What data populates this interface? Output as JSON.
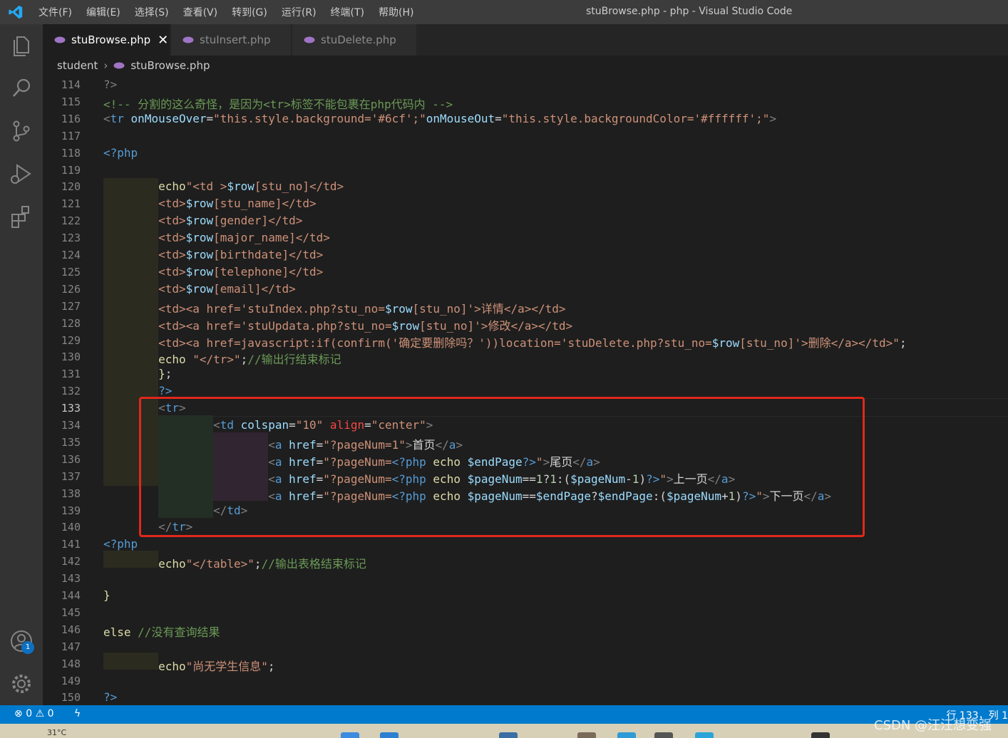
{
  "window": {
    "title": "stuBrowse.php - php - Visual Studio Code",
    "menu": [
      "文件(F)",
      "编辑(E)",
      "选择(S)",
      "查看(V)",
      "转到(G)",
      "运行(R)",
      "终端(T)",
      "帮助(H)"
    ]
  },
  "tabs": [
    {
      "label": "stuBrowse.php",
      "active": true,
      "close": "✕"
    },
    {
      "label": "stuInsert.php",
      "active": false
    },
    {
      "label": "stuDelete.php",
      "active": false
    }
  ],
  "breadcrumb": {
    "folder": "student",
    "separator": "›",
    "file": "stuBrowse.php"
  },
  "activity_bar": {
    "icons": [
      "explorer-icon",
      "search-icon",
      "source-control-icon",
      "run-debug-icon",
      "extensions-icon",
      "account-icon",
      "settings-gear-icon"
    ],
    "account_badge": "1"
  },
  "editor": {
    "active_line": "133",
    "highlight_color": "#e0281c",
    "lines": [
      {
        "n": "114",
        "segs": [
          {
            "c": "dim",
            "t": "?>"
          }
        ]
      },
      {
        "n": "115",
        "segs": [
          {
            "c": "cmt",
            "t": "<!-- 分割的这么奇怪，是因为<tr>标签不能包裹在php代码内 -->"
          }
        ]
      },
      {
        "n": "116",
        "segs": [
          {
            "c": "pun",
            "t": "<"
          },
          {
            "c": "tag",
            "t": "tr"
          },
          {
            "c": "txt",
            "t": " "
          },
          {
            "c": "attr",
            "t": "onMouseOver"
          },
          {
            "c": "txt",
            "t": "="
          },
          {
            "c": "str",
            "t": "\"this.style.background='#6cf';\""
          },
          {
            "c": "attr",
            "t": "onMouseOut"
          },
          {
            "c": "txt",
            "t": "="
          },
          {
            "c": "str",
            "t": "\"this.style.backgroundColor='#ffffff';\""
          },
          {
            "c": "pun",
            "t": ">"
          }
        ]
      },
      {
        "n": "117",
        "segs": []
      },
      {
        "n": "118",
        "segs": [
          {
            "c": "kw",
            "t": "<?php"
          }
        ]
      },
      {
        "n": "119",
        "segs": []
      },
      {
        "n": "120",
        "segs": [
          {
            "c": "txt",
            "t": "        "
          },
          {
            "c": "yel",
            "t": "echo"
          },
          {
            "c": "str",
            "t": "\"<td >"
          },
          {
            "c": "var",
            "t": "$row"
          },
          {
            "c": "str",
            "t": "[stu_no]</td>"
          }
        ]
      },
      {
        "n": "121",
        "segs": [
          {
            "c": "txt",
            "t": "        "
          },
          {
            "c": "str",
            "t": "<td>"
          },
          {
            "c": "var",
            "t": "$row"
          },
          {
            "c": "str",
            "t": "[stu_name]</td>"
          }
        ]
      },
      {
        "n": "122",
        "segs": [
          {
            "c": "txt",
            "t": "        "
          },
          {
            "c": "str",
            "t": "<td>"
          },
          {
            "c": "var",
            "t": "$row"
          },
          {
            "c": "str",
            "t": "[gender]</td>"
          }
        ]
      },
      {
        "n": "123",
        "segs": [
          {
            "c": "txt",
            "t": "        "
          },
          {
            "c": "str",
            "t": "<td>"
          },
          {
            "c": "var",
            "t": "$row"
          },
          {
            "c": "str",
            "t": "[major_name]</td>"
          }
        ]
      },
      {
        "n": "124",
        "segs": [
          {
            "c": "txt",
            "t": "        "
          },
          {
            "c": "str",
            "t": "<td>"
          },
          {
            "c": "var",
            "t": "$row"
          },
          {
            "c": "str",
            "t": "[birthdate]</td>"
          }
        ]
      },
      {
        "n": "125",
        "segs": [
          {
            "c": "txt",
            "t": "        "
          },
          {
            "c": "str",
            "t": "<td>"
          },
          {
            "c": "var",
            "t": "$row"
          },
          {
            "c": "str",
            "t": "[telephone]</td>"
          }
        ]
      },
      {
        "n": "126",
        "segs": [
          {
            "c": "txt",
            "t": "        "
          },
          {
            "c": "str",
            "t": "<td>"
          },
          {
            "c": "var",
            "t": "$row"
          },
          {
            "c": "str",
            "t": "[email]</td>"
          }
        ]
      },
      {
        "n": "127",
        "segs": [
          {
            "c": "txt",
            "t": "        "
          },
          {
            "c": "str",
            "t": "<td><a href='stuIndex.php?stu_no="
          },
          {
            "c": "var",
            "t": "$row"
          },
          {
            "c": "str",
            "t": "[stu_no]'>详情</a></td>"
          }
        ]
      },
      {
        "n": "128",
        "segs": [
          {
            "c": "txt",
            "t": "        "
          },
          {
            "c": "str",
            "t": "<td><a href='stuUpdata.php?stu_no="
          },
          {
            "c": "var",
            "t": "$row"
          },
          {
            "c": "str",
            "t": "[stu_no]'>修改</a></td>"
          }
        ]
      },
      {
        "n": "129",
        "segs": [
          {
            "c": "txt",
            "t": "        "
          },
          {
            "c": "str",
            "t": "<td><a href=javascript:if(confirm('确定要删除吗？'))location='stuDelete.php?stu_no="
          },
          {
            "c": "var",
            "t": "$row"
          },
          {
            "c": "str",
            "t": "[stu_no]'>删除</a></td>\""
          },
          {
            "c": "txt",
            "t": ";"
          }
        ]
      },
      {
        "n": "130",
        "segs": [
          {
            "c": "txt",
            "t": "        "
          },
          {
            "c": "yel",
            "t": "echo"
          },
          {
            "c": "txt",
            "t": " "
          },
          {
            "c": "str",
            "t": "\"</tr>\""
          },
          {
            "c": "txt",
            "t": ";"
          },
          {
            "c": "cmt",
            "t": "//输出行结束标记"
          }
        ]
      },
      {
        "n": "131",
        "segs": [
          {
            "c": "txt",
            "t": "        "
          },
          {
            "c": "yel",
            "t": "}"
          },
          {
            "c": "txt",
            "t": ";"
          }
        ]
      },
      {
        "n": "132",
        "segs": [
          {
            "c": "txt",
            "t": "        "
          },
          {
            "c": "kw",
            "t": "?>"
          }
        ]
      },
      {
        "n": "133",
        "segs": [
          {
            "c": "txt",
            "t": "        "
          },
          {
            "c": "pun",
            "t": "<"
          },
          {
            "c": "tag",
            "t": "tr"
          },
          {
            "c": "pun",
            "t": ">"
          }
        ]
      },
      {
        "n": "134",
        "segs": [
          {
            "c": "txt",
            "t": "                "
          },
          {
            "c": "pun",
            "t": "<"
          },
          {
            "c": "tag",
            "t": "td"
          },
          {
            "c": "txt",
            "t": " "
          },
          {
            "c": "attr",
            "t": "colspan"
          },
          {
            "c": "txt",
            "t": "="
          },
          {
            "c": "str",
            "t": "\"10\""
          },
          {
            "c": "txt",
            "t": " "
          },
          {
            "c": "red",
            "t": "align"
          },
          {
            "c": "txt",
            "t": "="
          },
          {
            "c": "str",
            "t": "\"center\""
          },
          {
            "c": "pun",
            "t": ">"
          }
        ]
      },
      {
        "n": "135",
        "segs": [
          {
            "c": "txt",
            "t": "                        "
          },
          {
            "c": "pun",
            "t": "<"
          },
          {
            "c": "tag",
            "t": "a"
          },
          {
            "c": "txt",
            "t": " "
          },
          {
            "c": "attr",
            "t": "href"
          },
          {
            "c": "txt",
            "t": "="
          },
          {
            "c": "str",
            "t": "\"?pageNum=1\""
          },
          {
            "c": "pun",
            "t": ">"
          },
          {
            "c": "txt",
            "t": "首页"
          },
          {
            "c": "pun",
            "t": "</"
          },
          {
            "c": "tag",
            "t": "a"
          },
          {
            "c": "pun",
            "t": ">"
          }
        ]
      },
      {
        "n": "136",
        "segs": [
          {
            "c": "txt",
            "t": "                        "
          },
          {
            "c": "pun",
            "t": "<"
          },
          {
            "c": "tag",
            "t": "a"
          },
          {
            "c": "txt",
            "t": " "
          },
          {
            "c": "attr",
            "t": "href"
          },
          {
            "c": "txt",
            "t": "="
          },
          {
            "c": "str",
            "t": "\"?pageNum="
          },
          {
            "c": "kw",
            "t": "<?php"
          },
          {
            "c": "txt",
            "t": " "
          },
          {
            "c": "yel",
            "t": "echo"
          },
          {
            "c": "txt",
            "t": " "
          },
          {
            "c": "var",
            "t": "$endPage"
          },
          {
            "c": "kw",
            "t": "?>"
          },
          {
            "c": "str",
            "t": "\""
          },
          {
            "c": "pun",
            "t": ">"
          },
          {
            "c": "txt",
            "t": "尾页"
          },
          {
            "c": "pun",
            "t": "</"
          },
          {
            "c": "tag",
            "t": "a"
          },
          {
            "c": "pun",
            "t": ">"
          }
        ]
      },
      {
        "n": "137",
        "segs": [
          {
            "c": "txt",
            "t": "                        "
          },
          {
            "c": "pun",
            "t": "<"
          },
          {
            "c": "tag",
            "t": "a"
          },
          {
            "c": "txt",
            "t": " "
          },
          {
            "c": "attr",
            "t": "href"
          },
          {
            "c": "txt",
            "t": "="
          },
          {
            "c": "str",
            "t": "\"?pageNum="
          },
          {
            "c": "kw",
            "t": "<?php"
          },
          {
            "c": "txt",
            "t": " "
          },
          {
            "c": "yel",
            "t": "echo"
          },
          {
            "c": "txt",
            "t": " "
          },
          {
            "c": "var",
            "t": "$pageNum"
          },
          {
            "c": "txt",
            "t": "=="
          },
          {
            "c": "num",
            "t": "1"
          },
          {
            "c": "txt",
            "t": "?"
          },
          {
            "c": "num",
            "t": "1"
          },
          {
            "c": "txt",
            "t": ":("
          },
          {
            "c": "var",
            "t": "$pageNum"
          },
          {
            "c": "txt",
            "t": "-"
          },
          {
            "c": "num",
            "t": "1"
          },
          {
            "c": "txt",
            "t": ")"
          },
          {
            "c": "kw",
            "t": "?>"
          },
          {
            "c": "str",
            "t": "\""
          },
          {
            "c": "pun",
            "t": ">"
          },
          {
            "c": "txt",
            "t": "上一页"
          },
          {
            "c": "pun",
            "t": "</"
          },
          {
            "c": "tag",
            "t": "a"
          },
          {
            "c": "pun",
            "t": ">"
          }
        ]
      },
      {
        "n": "138",
        "segs": [
          {
            "c": "txt",
            "t": "                        "
          },
          {
            "c": "pun",
            "t": "<"
          },
          {
            "c": "tag",
            "t": "a"
          },
          {
            "c": "txt",
            "t": " "
          },
          {
            "c": "attr",
            "t": "href"
          },
          {
            "c": "txt",
            "t": "="
          },
          {
            "c": "str",
            "t": "\"?pageNum="
          },
          {
            "c": "kw",
            "t": "<?php"
          },
          {
            "c": "txt",
            "t": " "
          },
          {
            "c": "yel",
            "t": "echo"
          },
          {
            "c": "txt",
            "t": " "
          },
          {
            "c": "var",
            "t": "$pageNum"
          },
          {
            "c": "txt",
            "t": "=="
          },
          {
            "c": "var",
            "t": "$endPage"
          },
          {
            "c": "txt",
            "t": "?"
          },
          {
            "c": "var",
            "t": "$endPage"
          },
          {
            "c": "txt",
            "t": ":("
          },
          {
            "c": "var",
            "t": "$pageNum"
          },
          {
            "c": "txt",
            "t": "+"
          },
          {
            "c": "num",
            "t": "1"
          },
          {
            "c": "txt",
            "t": ")"
          },
          {
            "c": "kw",
            "t": "?>"
          },
          {
            "c": "str",
            "t": "\""
          },
          {
            "c": "pun",
            "t": ">"
          },
          {
            "c": "txt",
            "t": "下一页"
          },
          {
            "c": "pun",
            "t": "</"
          },
          {
            "c": "tag",
            "t": "a"
          },
          {
            "c": "pun",
            "t": ">"
          }
        ]
      },
      {
        "n": "139",
        "segs": [
          {
            "c": "txt",
            "t": "                "
          },
          {
            "c": "pun",
            "t": "</"
          },
          {
            "c": "tag",
            "t": "td"
          },
          {
            "c": "pun",
            "t": ">"
          }
        ]
      },
      {
        "n": "140",
        "segs": [
          {
            "c": "txt",
            "t": "        "
          },
          {
            "c": "pun",
            "t": "</"
          },
          {
            "c": "tag",
            "t": "tr"
          },
          {
            "c": "pun",
            "t": ">"
          }
        ]
      },
      {
        "n": "141",
        "segs": [
          {
            "c": "kw",
            "t": "<?php"
          }
        ]
      },
      {
        "n": "142",
        "segs": [
          {
            "c": "txt",
            "t": "        "
          },
          {
            "c": "yel",
            "t": "echo"
          },
          {
            "c": "str",
            "t": "\"</table>\""
          },
          {
            "c": "txt",
            "t": ";"
          },
          {
            "c": "cmt",
            "t": "//输出表格结束标记"
          }
        ]
      },
      {
        "n": "143",
        "segs": []
      },
      {
        "n": "144",
        "segs": [
          {
            "c": "yel",
            "t": "}"
          }
        ]
      },
      {
        "n": "145",
        "segs": []
      },
      {
        "n": "146",
        "segs": [
          {
            "c": "yel",
            "t": "else"
          },
          {
            "c": "txt",
            "t": " "
          },
          {
            "c": "cmt",
            "t": "//没有查询结果"
          }
        ]
      },
      {
        "n": "147",
        "segs": []
      },
      {
        "n": "148",
        "segs": [
          {
            "c": "txt",
            "t": "        "
          },
          {
            "c": "yel",
            "t": "echo"
          },
          {
            "c": "str",
            "t": "\"尚无学生信息\""
          },
          {
            "c": "txt",
            "t": ";"
          }
        ]
      },
      {
        "n": "149",
        "segs": []
      },
      {
        "n": "150",
        "segs": [
          {
            "c": "kw",
            "t": "?>"
          }
        ]
      }
    ]
  },
  "status_bar": {
    "errors": "0",
    "warnings": "0",
    "position": "行 133，列 1"
  },
  "taskbar": {
    "temperature": "31°C"
  },
  "watermark": "CSDN @汪汪想变强",
  "colors": {
    "accent": "#007acc",
    "editor_bg": "#1e1e1e",
    "box": "#e0281c"
  }
}
